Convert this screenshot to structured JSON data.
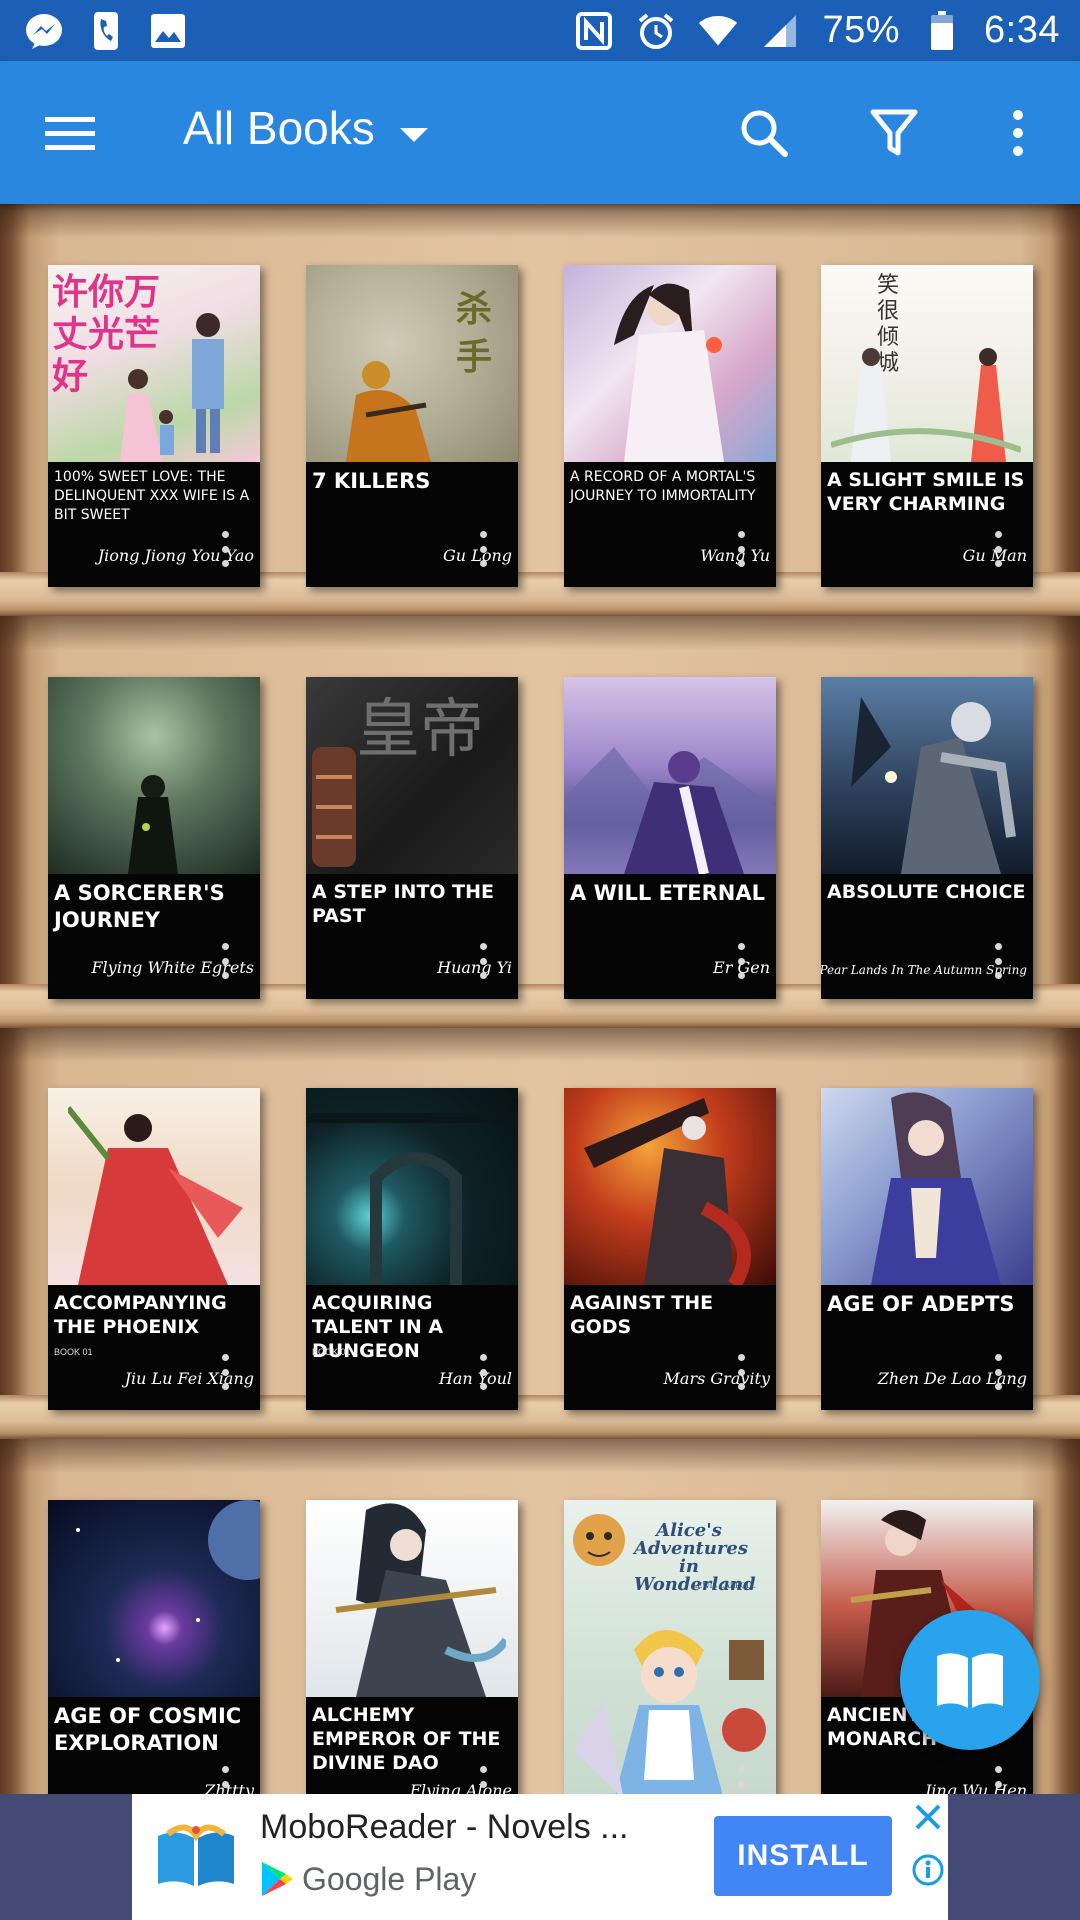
{
  "status_bar": {
    "left_icons": [
      "messenger-icon",
      "phone-icon",
      "gallery-icon"
    ],
    "right_icons": [
      "nfc-icon",
      "alarm-icon",
      "wifi-icon",
      "signal-icon"
    ],
    "battery": "75%",
    "time": "6:34"
  },
  "app_bar": {
    "menu_icon": "hamburger-menu-icon",
    "title": "All Books",
    "dropdown_icon": "dropdown-arrow-icon",
    "actions": [
      "search-icon",
      "filter-icon",
      "more-vert-icon"
    ],
    "color": "#2a87e0"
  },
  "books": [
    {
      "title": "100% Sweet Love: The Delinquent XXX Wife Is A Bit Sweet",
      "author": "Jiong Jiong You Yao",
      "cover_text": "许你万丈光芒好"
    },
    {
      "title": "7 Killers",
      "author": "Gu Long",
      "cover_text": "杀手"
    },
    {
      "title": "A Record of a Mortal's Journey to Immortality",
      "author": "Wang Yu"
    },
    {
      "title": "A Slight Smile Is Very Charming",
      "author": "Gu Man"
    },
    {
      "title": "A Sorcerer's Journey",
      "author": "Flying White Egrets"
    },
    {
      "title": "A Step Into The Past",
      "author": "Huang Yi"
    },
    {
      "title": "A Will Eternal",
      "author": "Er Gen"
    },
    {
      "title": "Absolute Choice",
      "author": "Pear Lands In The Autumn Spring"
    },
    {
      "title": "Accompanying The Phoenix",
      "subtitle": "BOOK 01",
      "author": "Jiu Lu Fei Xiang"
    },
    {
      "title": "Acquiring Talent In A Dungeon",
      "subtitle": "BOOK 01",
      "author": "Han Youl"
    },
    {
      "title": "Against The Gods",
      "author": "Mars Gravity"
    },
    {
      "title": "Age Of Adepts",
      "author": "Zhen De Lao Lang"
    },
    {
      "title": "Age Of Cosmic Exploration",
      "author": "Zhttty"
    },
    {
      "title": "Alchemy Emperor Of The Divine Dao",
      "author": "Flying Alone"
    },
    {
      "title": "",
      "author": "",
      "cover_text": "Alice's Adventures in Wonderland",
      "cover_subtext": "Lewis Carroll"
    },
    {
      "title": "Ancient Monarch",
      "author": "Jing Wu Hen"
    }
  ],
  "fab": {
    "icon": "open-book-icon",
    "color": "#29a3eb"
  },
  "ad": {
    "title": "MoboReader - Novels ...",
    "store": "Google Play",
    "install_label": "INSTALL",
    "close_icon": "close-icon",
    "info_icon": "info-icon"
  }
}
